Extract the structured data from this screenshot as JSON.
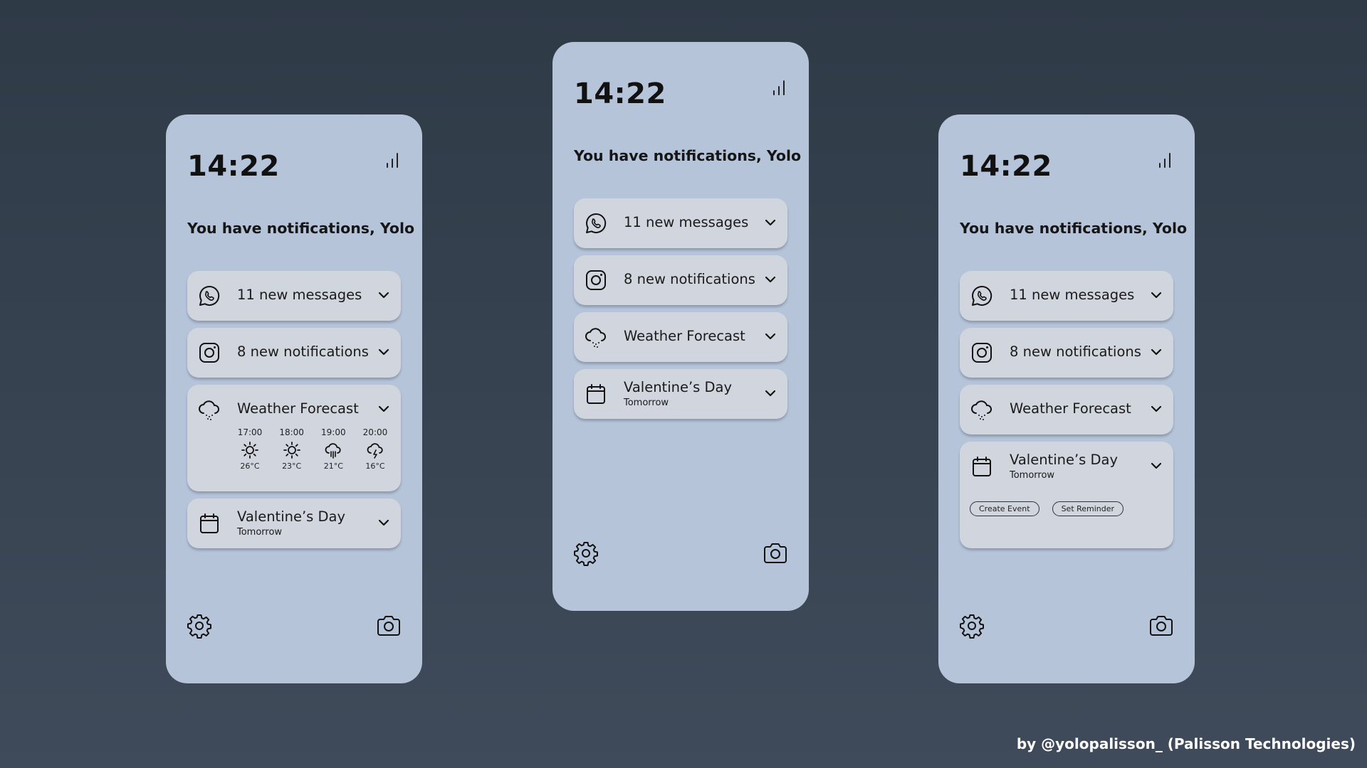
{
  "phones": {
    "left": {
      "time": "14:22",
      "greeting": "You have notifications, Yolo",
      "messages": {
        "label": "11 new messages",
        "icon": "whatsapp-icon"
      },
      "notifications": {
        "label": "8 new notifications",
        "icon": "instagram-icon"
      },
      "weather": {
        "label": "Weather Forecast",
        "icon": "cloud-drizzle-icon",
        "forecast": [
          {
            "time": "17:00",
            "icon": "sun-icon",
            "temp": "26°C"
          },
          {
            "time": "18:00",
            "icon": "sun-icon",
            "temp": "23°C"
          },
          {
            "time": "19:00",
            "icon": "cloud-rain-icon",
            "temp": "21°C"
          },
          {
            "time": "20:00",
            "icon": "cloud-lightning-icon",
            "temp": "16°C"
          }
        ]
      },
      "event": {
        "label": "Valentine’s Day",
        "sub": "Tomorrow",
        "icon": "calendar-icon"
      }
    },
    "center": {
      "time": "14:22",
      "greeting": "You have notifications, Yolo",
      "messages": {
        "label": "11 new messages"
      },
      "notifications": {
        "label": "8 new notifications"
      },
      "weather": {
        "label": "Weather Forecast"
      },
      "event": {
        "label": "Valentine’s Day",
        "sub": "Tomorrow"
      }
    },
    "right": {
      "time": "14:22",
      "greeting": "You have notifications, Yolo",
      "messages": {
        "label": "11 new messages"
      },
      "notifications": {
        "label": "8 new notifications"
      },
      "weather": {
        "label": "Weather Forecast"
      },
      "event": {
        "label": "Valentine’s Day",
        "sub": "Tomorrow",
        "actions": {
          "create": "Create Event",
          "reminder": "Set Reminder"
        }
      }
    }
  },
  "bottom_icons": [
    "gear-icon",
    "camera-icon"
  ],
  "credit": "by @yolopalisson_ (Palisson Technologies)",
  "colors": {
    "background_top": "#2f3a47",
    "background_bottom": "#3f4b5a",
    "phone": "#b6c4da",
    "card": "#d1d6de",
    "text": "#111111"
  }
}
